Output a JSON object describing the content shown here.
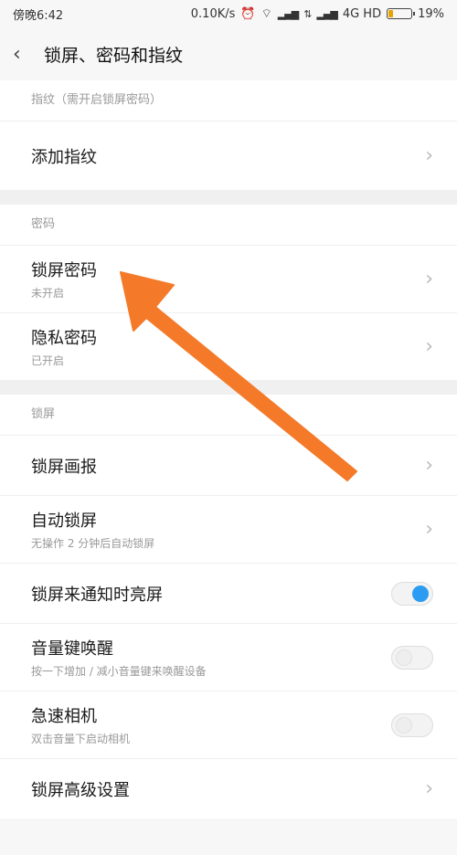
{
  "status": {
    "time": "傍晚6:42",
    "speed": "0.10K/s",
    "network": "4G HD",
    "battery": "19%"
  },
  "header": {
    "back_icon": "chevron-left-icon",
    "title": "锁屏、密码和指纹"
  },
  "sections": {
    "fingerprint": {
      "title": "指纹（需开启锁屏密码）",
      "items": [
        {
          "label": "添加指纹"
        }
      ]
    },
    "password": {
      "title": "密码",
      "items": [
        {
          "label": "锁屏密码",
          "sub": "未开启"
        },
        {
          "label": "隐私密码",
          "sub": "已开启"
        }
      ]
    },
    "lockscreen": {
      "title": "锁屏",
      "items": [
        {
          "label": "锁屏画报"
        },
        {
          "label": "自动锁屏",
          "sub": "无操作 2 分钟后自动锁屏"
        },
        {
          "label": "锁屏来通知时亮屏",
          "toggle": true
        },
        {
          "label": "音量键唤醒",
          "sub": "按一下增加 / 减小音量键来唤醒设备",
          "toggle": false
        },
        {
          "label": "急速相机",
          "sub": "双击音量下启动相机",
          "toggle": false
        },
        {
          "label": "锁屏高级设置"
        }
      ]
    }
  },
  "annotation": {
    "color": "#f47a2a",
    "icon": "arrow-annotation-icon"
  },
  "colors": {
    "toggle_on": "#2b9cf2",
    "background": "#f7f7f7"
  }
}
